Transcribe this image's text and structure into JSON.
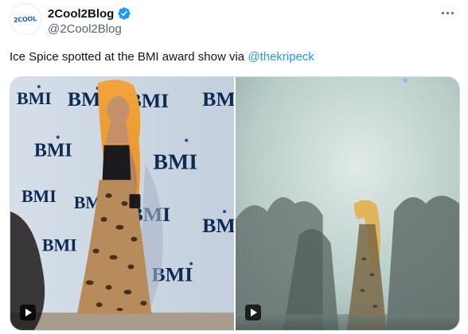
{
  "post": {
    "avatar_text": "2COOL",
    "display_name": "2Cool2Blog",
    "handle": "@2Cool2Blog",
    "text": "Ice Spice spotted at the BMI award show via ",
    "mention": "@thekripeck"
  },
  "media": {
    "backdrop_logo_text": "BMI",
    "items": [
      {
        "type": "video",
        "description_icon": "play-icon"
      },
      {
        "type": "video",
        "description_icon": "play-icon"
      }
    ]
  },
  "icons": {
    "verified": "verified-badge-icon",
    "more": "more-options-icon",
    "play": "play-icon"
  },
  "colors": {
    "link": "#1d9bf0",
    "verified": "#1d9bf0",
    "secondary_text": "#536471",
    "primary_text": "#0f1419"
  }
}
